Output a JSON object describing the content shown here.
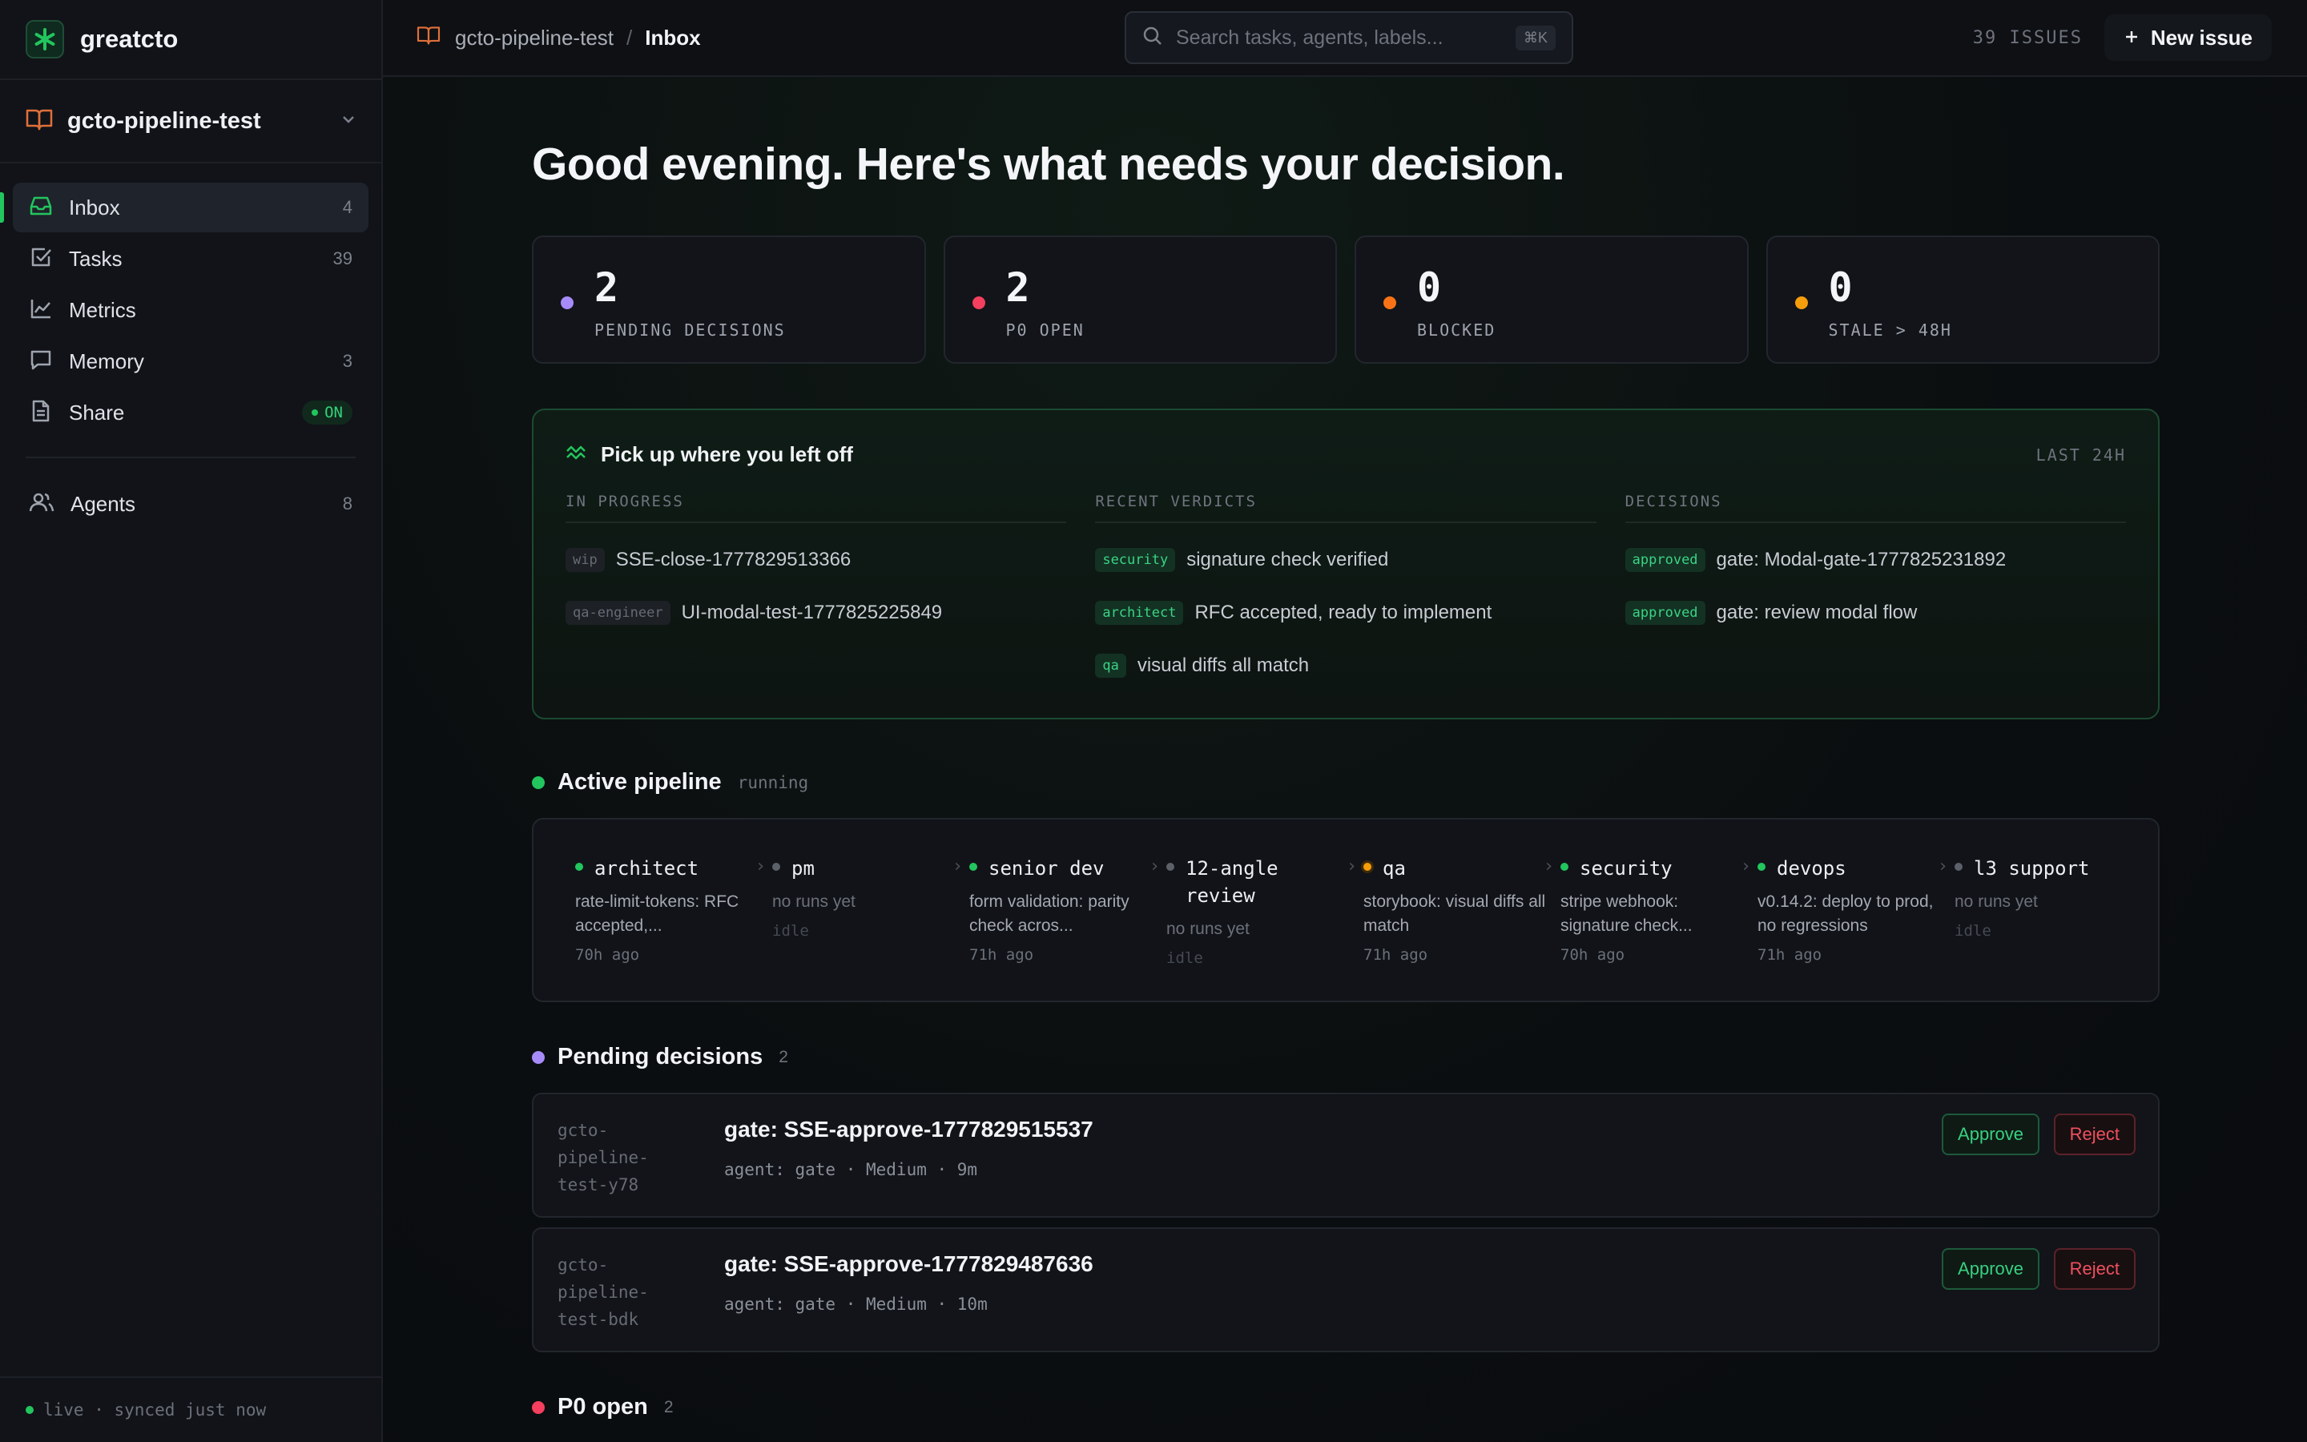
{
  "brand": {
    "name": "greatcto"
  },
  "project": {
    "name": "gcto-pipeline-test"
  },
  "nav": {
    "items": [
      {
        "label": "Inbox",
        "count": "4"
      },
      {
        "label": "Tasks",
        "count": "39"
      },
      {
        "label": "Metrics",
        "count": ""
      },
      {
        "label": "Memory",
        "count": "3"
      },
      {
        "label": "Share",
        "badge": "ON"
      }
    ],
    "agents": {
      "label": "Agents",
      "count": "8"
    }
  },
  "footer": {
    "status": "live · synced just now"
  },
  "topbar": {
    "crumb_project": "gcto-pipeline-test",
    "crumb_sep": "/",
    "crumb_current": "Inbox",
    "search_placeholder": "Search tasks, agents, labels...",
    "search_shortcut": "⌘K",
    "issues_count": "39 ISSUES",
    "new_issue_label": "New issue"
  },
  "greeting": "Good evening. Here's what needs your decision.",
  "stats": [
    {
      "value": "2",
      "label": "PENDING DECISIONS",
      "color": "#a78bfa"
    },
    {
      "value": "2",
      "label": "P0 OPEN",
      "color": "#f43f5e"
    },
    {
      "value": "0",
      "label": "BLOCKED",
      "color": "#f97316"
    },
    {
      "value": "0",
      "label": "STALE > 48H",
      "color": "#f59e0b"
    }
  ],
  "pickup": {
    "title": "Pick up where you left off",
    "range": "LAST 24H",
    "in_progress": {
      "header": "IN PROGRESS",
      "rows": [
        {
          "tag": "wip",
          "text": "SSE-close-1777829513366"
        },
        {
          "tag": "qa-engineer",
          "text": "UI-modal-test-1777825225849"
        }
      ]
    },
    "recent_verdicts": {
      "header": "RECENT VERDICTS",
      "rows": [
        {
          "tag": "security",
          "text": "signature check verified"
        },
        {
          "tag": "architect",
          "text": "RFC accepted, ready to implement"
        },
        {
          "tag": "qa",
          "text": "visual diffs all match"
        }
      ]
    },
    "decisions": {
      "header": "DECISIONS",
      "rows": [
        {
          "tag": "approved",
          "text": "gate: Modal-gate-1777825231892"
        },
        {
          "tag": "approved",
          "text": "gate: review modal flow"
        }
      ]
    }
  },
  "pipeline": {
    "title": "Active pipeline",
    "status": "running",
    "stages": [
      {
        "name": "architect",
        "desc": "rate-limit-tokens: RFC accepted,...",
        "time": "70h ago",
        "dot": "#22c55e"
      },
      {
        "name": "pm",
        "desc": "no runs yet",
        "time": "idle",
        "dot": "#5b6069"
      },
      {
        "name": "senior dev",
        "desc": "form validation: parity check acros...",
        "time": "71h ago",
        "dot": "#22c55e"
      },
      {
        "name": "12-angle review",
        "desc": "no runs yet",
        "time": "idle",
        "dot": "#5b6069"
      },
      {
        "name": "qa",
        "desc": "storybook: visual diffs all match",
        "time": "71h ago",
        "dot": "#f59e0b"
      },
      {
        "name": "security",
        "desc": "stripe webhook: signature check...",
        "time": "70h ago",
        "dot": "#22c55e"
      },
      {
        "name": "devops",
        "desc": "v0.14.2: deploy to prod, no regressions",
        "time": "71h ago",
        "dot": "#22c55e"
      },
      {
        "name": "l3 support",
        "desc": "no runs yet",
        "time": "idle",
        "dot": "#5b6069"
      }
    ]
  },
  "pending": {
    "title": "Pending decisions",
    "count": "2",
    "items": [
      {
        "id": "gcto-pipeline-test-y78",
        "title": "gate: SSE-approve-1777829515537",
        "meta": "agent: gate · Medium · 9m",
        "approve": "Approve",
        "reject": "Reject"
      },
      {
        "id": "gcto-pipeline-test-bdk",
        "title": "gate: SSE-approve-1777829487636",
        "meta": "agent: gate · Medium · 10m",
        "approve": "Approve",
        "reject": "Reject"
      }
    ]
  },
  "p0": {
    "title": "P0 open",
    "count": "2"
  },
  "colors": {
    "accent": "#22c55e",
    "pending": "#a78bfa",
    "p0": "#f43f5e",
    "reject": "#f0505e"
  }
}
